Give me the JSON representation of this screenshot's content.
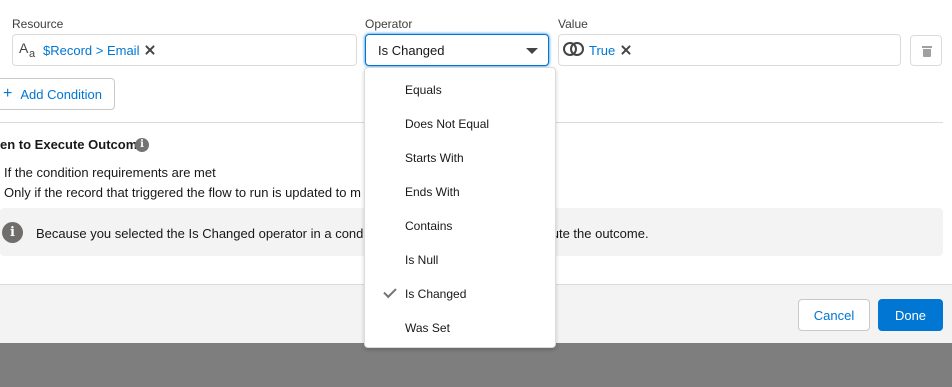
{
  "labels": {
    "resource": "Resource",
    "operator": "Operator",
    "value": "Value"
  },
  "resource": {
    "text": "$Record > Email",
    "icon": "text-type-icon"
  },
  "operator": {
    "selected": "Is Changed"
  },
  "value": {
    "text": "True",
    "icon": "boolean-icon"
  },
  "add_condition": {
    "plus": "+",
    "label": "Add Condition"
  },
  "section": {
    "title": "en to Execute Outcome",
    "info_glyph": "i",
    "option1": "If the condition requirements are met",
    "option2": "Only if the record that triggered the flow to run is updated to m"
  },
  "notice": {
    "glyph": "i",
    "text_part1": "Because you selected the Is Changed operator in a condit",
    "text_part2": "ecute the outcome."
  },
  "dropdown": {
    "options": [
      "Equals",
      "Does Not Equal",
      "Starts With",
      "Ends With",
      "Contains",
      "Is Null",
      "Is Changed",
      "Was Set"
    ],
    "selected_index": 6
  },
  "footer": {
    "cancel": "Cancel",
    "done": "Done"
  },
  "colors": {
    "brand": "#0176d3",
    "footer_bg": "#f3f3f3",
    "backdrop": "#7e7e7e"
  }
}
